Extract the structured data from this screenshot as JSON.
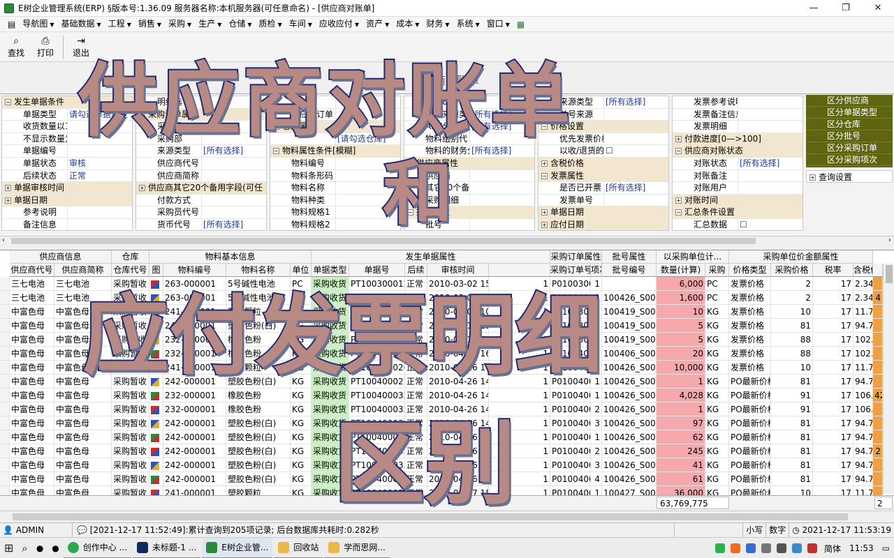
{
  "window": {
    "title": "E树企业管理系统(ERP) §版本号:1.36.09  服务器名称:本机服务器(可任意命名) - [供应商对账单]",
    "buttons": [
      "—",
      "❐",
      "✕"
    ]
  },
  "menu": [
    "导航图",
    "基础数据",
    "工程",
    "销售",
    "采购",
    "生产",
    "仓储",
    "质检",
    "车间",
    "应收应付",
    "资产",
    "成本",
    "财务",
    "系统",
    "窗口"
  ],
  "toolbar": {
    "find": "查找",
    "print": "打印",
    "exit": "退出"
  },
  "doc_title": "供应商对账单",
  "filters": {
    "col1": [
      {
        "t": "grp",
        "label": "发生单据条件",
        "sign": "−"
      },
      {
        "label": "单据类型",
        "value": "请勾选单据类型"
      },
      {
        "label": "收货数量以1",
        "value": ""
      },
      {
        "label": "不显示数量为",
        "value": ""
      },
      {
        "label": "单据编号",
        "value": ""
      },
      {
        "label": "单据状态",
        "value": "审核"
      },
      {
        "label": "后续状态",
        "value": "正常"
      },
      {
        "t": "grp",
        "label": "单据审核时间",
        "sign": "+"
      },
      {
        "t": "grp",
        "label": "单据日期",
        "sign": "+"
      },
      {
        "label": "参考说明",
        "value": ""
      },
      {
        "label": "备注信息",
        "value": ""
      }
    ],
    "col2": [
      {
        "label": "明细选",
        "value": ""
      },
      {
        "t": "grp",
        "label": "采购订单属性",
        "sign": "−"
      },
      {
        "label": "采购员",
        "value": ""
      },
      {
        "label": "采购部",
        "value": ""
      },
      {
        "label": "来源类型",
        "value": "[所有选择]"
      },
      {
        "label": "供应商代号",
        "value": ""
      },
      {
        "label": "供应商简称",
        "value": ""
      },
      {
        "t": "grp",
        "label": "供应商其它20个备用字段(可任",
        "sign": "+"
      },
      {
        "label": "付款方式",
        "value": ""
      },
      {
        "label": "采购员代号",
        "value": ""
      },
      {
        "label": "货币代号",
        "value": "[所有选择]"
      }
    ],
    "col3": [
      {
        "label": "称",
        "value": ""
      },
      {
        "label": "供应商订单",
        "value": ""
      },
      {
        "t": "grp",
        "label": "仓库属性",
        "sign": "−"
      },
      {
        "label": "",
        "value": "[请勾选仓库]"
      },
      {
        "t": "grp",
        "label": "物料属性条件[模糊]",
        "sign": "−"
      },
      {
        "label": "物料编号",
        "value": ""
      },
      {
        "label": "物料条形码",
        "value": ""
      },
      {
        "label": "物料名称",
        "value": ""
      },
      {
        "label": "物料种类",
        "value": ""
      },
      {
        "label": "物料规格1",
        "value": ""
      },
      {
        "label": "物料规格2",
        "value": ""
      }
    ],
    "col4": [
      {
        "label": "其它60个备用字段",
        "value": ""
      },
      {
        "label": "预测来源类型",
        "value": "[所有选择]"
      },
      {
        "label": "ABC分类",
        "value": "[所有选择]"
      },
      {
        "label": "物料组别代",
        "value": ""
      },
      {
        "label": "物料的财务分",
        "value": "[所有选择]"
      },
      {
        "t": "grp",
        "label": "供应商属性",
        "sign": "−"
      },
      {
        "label": "供应商",
        "value": ""
      },
      {
        "label": "其它20个备用字段(可任意",
        "value": ""
      },
      {
        "label": "采购明细",
        "value": ""
      },
      {
        "t": "grp",
        "label": "批号属性",
        "sign": "−"
      },
      {
        "label": "批号",
        "value": ""
      }
    ],
    "col5": [
      {
        "label": "来源类型",
        "value": "[所有选择]"
      },
      {
        "label": "单号来源",
        "value": ""
      },
      {
        "t": "grp",
        "label": "价格设置",
        "sign": "−"
      },
      {
        "label": "优先发票价格",
        "value": ""
      },
      {
        "label": "以收/退货的",
        "value": "☐"
      },
      {
        "t": "grp",
        "label": "含税价格",
        "sign": "+"
      },
      {
        "t": "grp",
        "label": "发票属性",
        "sign": "−"
      },
      {
        "label": "是否已开票",
        "value": "[所有选择]"
      },
      {
        "label": "发票单号",
        "value": ""
      },
      {
        "t": "grp",
        "label": "单据日期",
        "sign": "+"
      },
      {
        "t": "grp",
        "label": "应付日期",
        "sign": "+"
      }
    ],
    "col6": [
      {
        "label": "发票参考说明",
        "value": ""
      },
      {
        "label": "发票备注信息",
        "value": ""
      },
      {
        "label": "发票明细",
        "value": ""
      },
      {
        "t": "grp",
        "label": "付款进度[0—>100]",
        "sign": "+"
      },
      {
        "t": "grp",
        "label": "供应商对账状态",
        "sign": "−"
      },
      {
        "label": "对账状态",
        "value": "[所有选择]"
      },
      {
        "label": "对账备注",
        "value": ""
      },
      {
        "label": "对账用户",
        "value": ""
      },
      {
        "t": "grp",
        "label": "对账时间",
        "sign": "+"
      },
      {
        "t": "grp",
        "label": "汇总条件设置",
        "sign": "−"
      },
      {
        "label": "汇总数据",
        "value": "☐"
      }
    ]
  },
  "right_panel": {
    "items": [
      "区分供应商",
      "区分单据类型",
      "区分仓库",
      "区分批号",
      "区分采购订单",
      "区分采购项次"
    ],
    "config": "查询设置"
  },
  "grid": {
    "groups": [
      "供应商信息",
      "仓库",
      "物料基本信息",
      "发生单据属性",
      "采购订单属性",
      "批号属性",
      "以采购单位计...",
      "采购单位价金额属性"
    ],
    "columns": [
      "供应商代号",
      "供应商简称",
      "仓库代号",
      "图",
      "物料编号",
      "物料名称",
      "单位",
      "单据类型",
      "单据号",
      "后续",
      "审核时间",
      "",
      "采购订单号",
      "项次",
      "批号编号",
      "数量(计算)",
      "采购",
      "价格类型",
      "采购价格",
      "税率",
      "含税价格",
      ""
    ],
    "rows": [
      [
        "三七电池",
        "三七电池",
        "采购暂收",
        "",
        "263-000001",
        "5号碱性电池",
        "PC",
        "采购收货",
        "PT100300012",
        "正常",
        "2010-03-02 15:45",
        "1",
        "P0100300012",
        "1",
        "",
        "6,000",
        "PC",
        "发票价格",
        "2",
        "17",
        "2.34",
        ""
      ],
      [
        "三七电池",
        "三七电池",
        "采购暂收",
        "",
        "263-000001",
        "5号碱性电池",
        "PC",
        "采购收货",
        "PT100300012",
        "正常",
        "2010-03-09 14:28",
        "1",
        "P0100400094",
        "1",
        "100426_S0001",
        "1,600",
        "PC",
        "发票价格",
        "2",
        "17",
        "2.34",
        "4"
      ],
      [
        "中富色母",
        "中富色母",
        "采购暂收",
        "",
        "241-000001",
        "塑胶颗粒",
        "KG",
        "采购收货",
        "PT100300007",
        "正常",
        "2010-03-09 10:45",
        "1",
        "P0100300007",
        "1",
        "100419_S0001",
        "10",
        "KG",
        "发票价格",
        "10",
        "17",
        "11.7",
        ""
      ],
      [
        "中富色母",
        "中富色母",
        "采购暂收",
        "",
        "242-000001",
        "塑胶色粉(白)",
        "KG",
        "采购收货",
        "PT100300008",
        "正常",
        "2010-03-16 13:20",
        "1",
        "P0100300008",
        "2",
        "100419_S0001",
        "5",
        "KG",
        "发票价格",
        "81",
        "17",
        "94.77",
        ""
      ],
      [
        "中富色母",
        "中富色母",
        "采购暂收",
        "",
        "232-000001",
        "橡胶色粉",
        "KG",
        "采购收货",
        "PT100300008",
        "正常",
        "2010-03-16 14:02",
        "1",
        "P0100300008",
        "1",
        "100419_S0001",
        "5",
        "KG",
        "发票价格",
        "88",
        "17",
        "102.96",
        ""
      ],
      [
        "中富色母",
        "中富色母",
        "采购暂收",
        "",
        "232-000001",
        "橡胶色粉",
        "KG",
        "采购收货",
        "PT100400005",
        "正常",
        "2010-04-06 16:07:00",
        "1",
        "P0100400005",
        "1",
        "100406_S0001",
        "20",
        "KG",
        "发票价格",
        "88",
        "17",
        "102.96",
        ""
      ],
      [
        "中富色母",
        "中富色母",
        "采购暂收",
        "",
        "241-000001",
        "塑胶颗粒",
        "KG",
        "采购收货",
        "PT100400026",
        "正常",
        "2010-04-26 14:44:12",
        "1",
        "P0100400091",
        "1",
        "100426_S0001",
        "10,000",
        "KG",
        "发票价格",
        "10",
        "17",
        "11.7",
        ""
      ],
      [
        "中富色母",
        "中富色母",
        "采购暂收",
        "",
        "242-000001",
        "塑胶色粉(白)",
        "KG",
        "采购收货",
        "PT100400027",
        "正常",
        "2010-04-26 14:45:22",
        "1",
        "P0100400099",
        "1",
        "100426_S0001",
        "1",
        "KG",
        "PO最新价格",
        "81",
        "17",
        "94.77",
        ""
      ],
      [
        "中富色母",
        "中富色母",
        "采购暂收",
        "",
        "232-000001",
        "橡胶色粉",
        "KG",
        "采购收货",
        "PT100400032",
        "正常",
        "2010-04-26 14:47:25",
        "1",
        "P0100400104",
        "1",
        "100426_S0001",
        "4,028",
        "KG",
        "PO最新价格",
        "91",
        "17",
        "106.47",
        "42"
      ],
      [
        "中富色母",
        "中富色母",
        "采购暂收",
        "",
        "232-000001",
        "橡胶色粉",
        "KG",
        "采购收货",
        "PT100400032",
        "正常",
        "2010-04-26 14:47:25",
        "1",
        "P0100400104",
        "2",
        "100426_S0001",
        "1",
        "KG",
        "PO最新价格",
        "91",
        "17",
        "106.47",
        ""
      ],
      [
        "中富色母",
        "中富色母",
        "采购暂收",
        "",
        "242-000001",
        "塑胶色粉(白)",
        "KG",
        "采购收货",
        "PT100400032",
        "正常",
        "2010-04-26 14:47:25",
        "1",
        "P0100400104",
        "3",
        "100426_S0001",
        "97",
        "KG",
        "PO最新价格",
        "81",
        "17",
        "94.77",
        ""
      ],
      [
        "中富色母",
        "中富色母",
        "采购暂收",
        "",
        "242-000001",
        "塑胶色粉(白)",
        "KG",
        "采购收货",
        "PT100400033",
        "正常",
        "2010-04-26 14:47:36",
        "1",
        "P0100400111",
        "1",
        "100426_S0001",
        "62",
        "KG",
        "PO最新价格",
        "81",
        "17",
        "94.77",
        ""
      ],
      [
        "中富色母",
        "中富色母",
        "采购暂收",
        "",
        "242-000001",
        "塑胶色粉(白)",
        "KG",
        "采购收货",
        "PT100400033",
        "正常",
        "2010-04-26 14:47:36",
        "1",
        "P0100400111",
        "2",
        "100426_S0001",
        "245",
        "KG",
        "PO最新价格",
        "81",
        "17",
        "94.77",
        "2"
      ],
      [
        "中富色母",
        "中富色母",
        "采购暂收",
        "",
        "242-000001",
        "塑胶色粉(白)",
        "KG",
        "采购收货",
        "PT100400033",
        "正常",
        "2010-04-26 14:47:36",
        "1",
        "P0100400111",
        "3",
        "100426_S0001",
        "41",
        "KG",
        "PO最新价格",
        "81",
        "17",
        "94.77",
        ""
      ],
      [
        "中富色母",
        "中富色母",
        "采购暂收",
        "",
        "242-000001",
        "塑胶色粉(白)",
        "KG",
        "采购收货",
        "PT100400033",
        "正常",
        "2010-04-26 14:47:36",
        "1",
        "P0100400111",
        "4",
        "100426_S0001",
        "61",
        "KG",
        "PO最新价格",
        "81",
        "17",
        "94.77",
        ""
      ],
      [
        "中富色母",
        "中富色母",
        "采购暂收",
        "",
        "241-000001",
        "塑胶颗粒",
        "KG",
        "采购收货",
        "PT100400034",
        "正常",
        "2010-04-27 15:35:42",
        "1",
        "P0100400113",
        "1",
        "100427_S0001",
        "36,000",
        "KG",
        "PO最新价格",
        "10",
        "17",
        "11.7",
        ""
      ]
    ],
    "total": "63,769,775",
    "page": "2"
  },
  "status": {
    "user": "ADMIN",
    "message": "[2021-12-17 11:52:49]:累计查询到205项记录; 后台数据库共耗时:0.282秒",
    "caps": "小写",
    "num": "数字",
    "time": "2021-12-17 11:53:19"
  },
  "taskbar": {
    "apps": [
      "创作中心 ...",
      "未标题-1 ...",
      "E树企业管...",
      "回收站",
      "学而思网..."
    ],
    "ime": "简体",
    "clock": "11:53"
  },
  "overlay_text": {
    "line1": "供应商对账单",
    "line2": "和",
    "line3": "应付发票明细",
    "line4": "区别"
  },
  "colors": {
    "green_cell": "#c8f0c0",
    "pink_cell": "#f7a8ab",
    "right_panel": "#5f6410",
    "overlay_fill": "#b98a84",
    "overlay_stroke": "#1f2a72"
  }
}
